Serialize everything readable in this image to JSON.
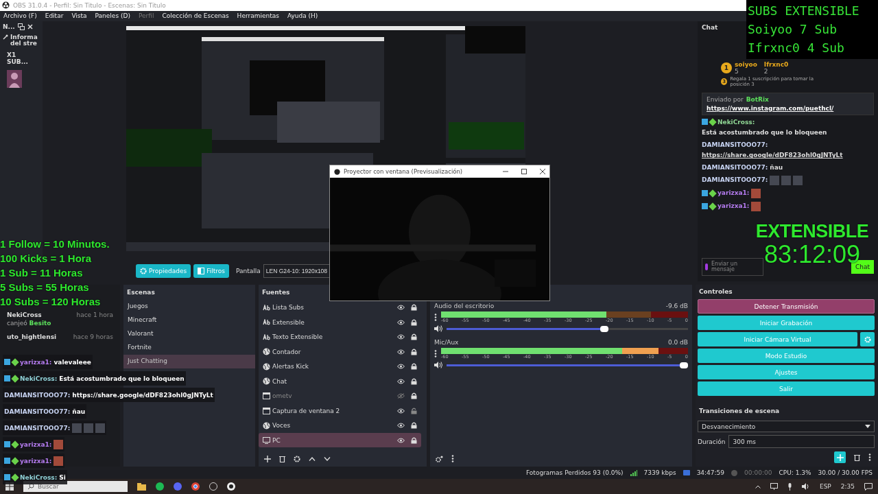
{
  "window": {
    "title": "OBS 31.0.4 - Perfil: Sin Titulo - Escenas: Sin Titulo"
  },
  "menu": [
    {
      "label": "Archivo (F)",
      "disabled": false
    },
    {
      "label": "Editar",
      "disabled": false
    },
    {
      "label": "Vista",
      "disabled": false
    },
    {
      "label": "Paneles (D)",
      "disabled": false
    },
    {
      "label": "Perfil",
      "disabled": true
    },
    {
      "label": "Colección de Escenas",
      "disabled": false
    },
    {
      "label": "Herramientas",
      "disabled": false
    },
    {
      "label": "Ayuda (H)",
      "disabled": false
    }
  ],
  "left_dock": {
    "title": "N...",
    "section": "Informa del stre",
    "label": "X1 SUB..."
  },
  "projector": {
    "title": "Proyector con ventana (Previsualización)"
  },
  "chat_dock": {
    "title": "Chat",
    "leaders": [
      {
        "rank": "1",
        "name": "soiyoo",
        "count": "5"
      },
      {
        "name": "Ifrxnc0",
        "count": "2"
      }
    ],
    "next_rank": "3",
    "next_text": "Regala 1 suscripción para tomar la posición 3",
    "pinned": {
      "prefix": "Enviado por",
      "sender": "BotRix",
      "link": "https://www.instagram.com/puethcl/"
    },
    "messages": [
      {
        "user": "NekiCross:",
        "color": "#8fd694",
        "text": "Está acostumbrado que lo bloqueen",
        "kind": "text",
        "badged": true
      },
      {
        "user": "DAMIANSITOOO77:",
        "color": "#c7d3f2",
        "text": "https://share.google/dDF823ohl0gJNTyLt",
        "kind": "link",
        "badged": false
      },
      {
        "user": "DAMIANSITOOO77:",
        "color": "#c7d3f2",
        "text": "ñau",
        "kind": "text",
        "badged": false
      },
      {
        "user": "DAMIANSITOOO77:",
        "color": "#c7d3f2",
        "kind": "emotes",
        "badged": false
      },
      {
        "user": "yarizxa1:",
        "color": "#b57cf0",
        "kind": "emote",
        "badged": true
      },
      {
        "user": "yarizxa1:",
        "color": "#b57cf0",
        "kind": "emote",
        "badged": true
      }
    ],
    "input_placeholder": "Enviar un mensaje",
    "send": "Chat"
  },
  "toolbar": {
    "buttons": [
      "Propiedades",
      "Filtros"
    ],
    "source_label": "Pantalla",
    "display": "LEN G24-10: 1920x108"
  },
  "activities": {
    "items": [
      {
        "user": "NekiCross",
        "time": "hace 1 hora",
        "action": "canjeó",
        "reward": "Besito"
      },
      {
        "user": "uto_hightlensi",
        "time": "hace 9 horas"
      }
    ]
  },
  "scenes": {
    "title": "Escenas",
    "items": [
      {
        "label": "Juegos",
        "selected": false
      },
      {
        "label": "Minecraft",
        "selected": false
      },
      {
        "label": "Valorant",
        "selected": false
      },
      {
        "label": "Fortnite",
        "selected": false
      },
      {
        "label": "Just Chatting",
        "selected": true
      }
    ]
  },
  "sources": {
    "title": "Fuentes",
    "items": [
      {
        "label": "Lista Subs",
        "kind": "text",
        "visible": true,
        "locked": true,
        "selected": false
      },
      {
        "label": "Extensible",
        "kind": "text",
        "visible": true,
        "locked": true,
        "selected": false
      },
      {
        "label": "Texto Extensible",
        "kind": "text",
        "visible": true,
        "locked": true,
        "selected": false
      },
      {
        "label": "Contador",
        "kind": "browser",
        "visible": true,
        "locked": true,
        "selected": false
      },
      {
        "label": "Alertas Kick",
        "kind": "browser",
        "visible": true,
        "locked": true,
        "selected": false
      },
      {
        "label": "Chat",
        "kind": "browser",
        "visible": true,
        "locked": true,
        "selected": false
      },
      {
        "label": "ometv",
        "kind": "window",
        "visible": false,
        "locked": true,
        "selected": false
      },
      {
        "label": "Captura de ventana 2",
        "kind": "window",
        "visible": true,
        "locked": false,
        "selected": false
      },
      {
        "label": "Voces",
        "kind": "browser",
        "visible": true,
        "locked": true,
        "selected": false
      },
      {
        "label": "PC",
        "kind": "monitor",
        "visible": true,
        "locked": true,
        "selected": true
      }
    ]
  },
  "mixer": {
    "channels": [
      {
        "name": "Audio del escritorio",
        "reading": "-9.6 dB",
        "meter": {
          "level": 0.67
        },
        "fader": {
          "level": 0.66
        },
        "scale": [
          "-60",
          "-55",
          "-50",
          "-45",
          "-40",
          "-35",
          "-30",
          "-25",
          "-20",
          "-15",
          "-10",
          "-5",
          "0"
        ]
      },
      {
        "name": "Mic/Aux",
        "reading": "0.0 dB",
        "meter": {
          "level": 0.88
        },
        "fader": {
          "level": 1.0
        },
        "scale": [
          "-60",
          "-55",
          "-50",
          "-45",
          "-40",
          "-35",
          "-30",
          "-25",
          "-20",
          "-15",
          "-10",
          "-5",
          "0"
        ]
      }
    ]
  },
  "controls": {
    "title": "Controles",
    "buttons": [
      {
        "label": "Detener Transmisión",
        "kind": "stop"
      },
      {
        "label": "Iniciar Grabación",
        "kind": "plain"
      },
      {
        "label": "Iniciar Cámara Virtual",
        "kind": "gear"
      },
      {
        "label": "Modo Estudio",
        "kind": "plain"
      },
      {
        "label": "Ajustes",
        "kind": "plain"
      },
      {
        "label": "Salir",
        "kind": "plain"
      }
    ]
  },
  "transitions": {
    "title": "Transiciones de escena",
    "value": "Desvanecimiento",
    "duration_label": "Duración",
    "duration": "300 ms"
  },
  "status_bar": {
    "dropped": "Fotogramas Perdidos 93 (0.0%)",
    "bitrate": "7339 kbps",
    "stream_time": "34:47:59",
    "record_time": "00:00:00",
    "cpu": "CPU: 1.3%",
    "fps": "30.00 / 30.00 FPS"
  },
  "taskbar": {
    "search_placeholder": "Buscar",
    "language": "ESP",
    "time": "2:35"
  },
  "overlays": {
    "subs": [
      "SUBS EXTENSIBLE",
      "Soiyoo 7 Sub",
      "Ifrxnc0 4 Sub"
    ],
    "rules": [
      "1 Follow = 10 Minutos.",
      "100 Kicks = 1 Hora",
      "1 Sub = 11 Horas",
      "5 Subs = 55 Horas",
      "10 Subs = 120 Horas"
    ],
    "timer": {
      "title": "EXTENSIBLE",
      "time": "83:12:09"
    },
    "chat": [
      {
        "user": "yarizxa1:",
        "color": "#b57cf0",
        "text": "valevaleee",
        "kind": "text",
        "badged": true
      },
      {
        "user": "NekiCross:",
        "color": "#8fd0d6",
        "text": "Está acostumbrado que lo bloqueen",
        "kind": "text",
        "badged": true
      },
      {
        "user": "DAMIANSITOOO77:",
        "color": "#c7d3f2",
        "text": "https://share.google/dDF823ohl0gJNTyLt",
        "kind": "text",
        "badged": false
      },
      {
        "user": "DAMIANSITOOO77:",
        "color": "#c7d3f2",
        "text": "ñau",
        "kind": "text",
        "badged": false
      },
      {
        "user": "DAMIANSITOOO77:",
        "color": "#c7d3f2",
        "kind": "emotes",
        "badged": false
      },
      {
        "user": "yarizxa1:",
        "color": "#b57cf0",
        "kind": "emote",
        "badged": true
      },
      {
        "user": "yarizxa1:",
        "color": "#b57cf0",
        "kind": "emote",
        "badged": true
      },
      {
        "user": "NekiCross:",
        "color": "#8fd0d6",
        "text": "Si",
        "kind": "text",
        "badged": true
      }
    ]
  }
}
